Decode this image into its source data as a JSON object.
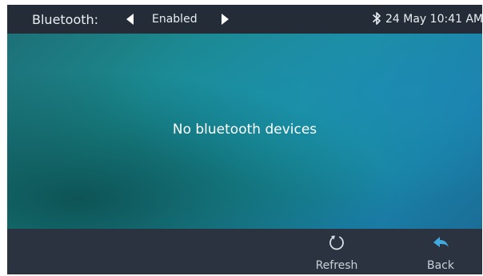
{
  "topbar": {
    "setting_label": "Bluetooth:",
    "setting_value": "Enabled",
    "datetime": "24 May 10:41 AM",
    "status_icon": "bluetooth-icon"
  },
  "content": {
    "empty_message": "No bluetooth devices"
  },
  "softkeys": {
    "refresh": {
      "label": "Refresh",
      "icon": "refresh-icon"
    },
    "back": {
      "label": "Back",
      "icon": "back-arrow-icon"
    }
  },
  "colors": {
    "topbar_bg": "#242c37",
    "softbar_bg": "#2b3341",
    "back_icon": "#3fa9e0",
    "text": "#ffffff"
  }
}
